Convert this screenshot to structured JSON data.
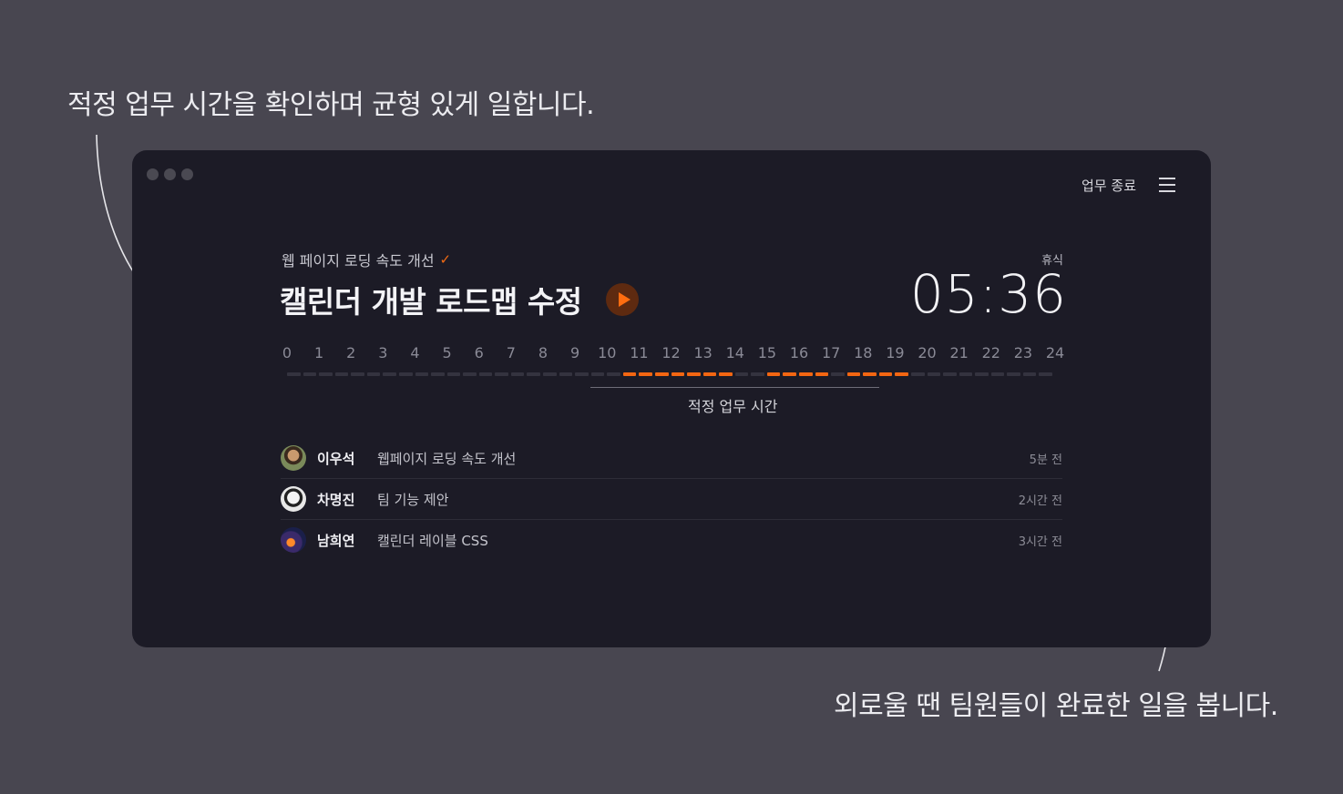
{
  "captions": {
    "top": "적정 업무 시간을 확인하며 균형 있게 일합니다.",
    "bottom": "외로울 땐 팀원들이 완료한 일을 봅니다."
  },
  "header": {
    "end_work": "업무 종료",
    "menu_icon": "hamburger-menu-icon"
  },
  "current": {
    "project": "웹 페이지 로딩 속도 개선",
    "project_check_icon": "check-icon",
    "task": "캘린더 개발 로드맵 수정",
    "status_label": "휴식",
    "timer": "05:36"
  },
  "timeline": {
    "hours": [
      "0",
      "1",
      "2",
      "3",
      "4",
      "5",
      "6",
      "7",
      "8",
      "9",
      "10",
      "11",
      "12",
      "13",
      "14",
      "15",
      "16",
      "17",
      "18",
      "19",
      "20",
      "21",
      "22",
      "23",
      "24"
    ],
    "range_label": "적정 업무 시간",
    "accent_color": "#f36612",
    "inactive_color": "#34333f"
  },
  "feed": [
    {
      "name": "이우석",
      "task": "웹페이지 로딩 속도 개선",
      "time": "5분 전"
    },
    {
      "name": "차명진",
      "task": "팀 기능 제안",
      "time": "2시간 전"
    },
    {
      "name": "남희연",
      "task": "캘린더 레이블 CSS",
      "time": "3시간 전"
    }
  ]
}
